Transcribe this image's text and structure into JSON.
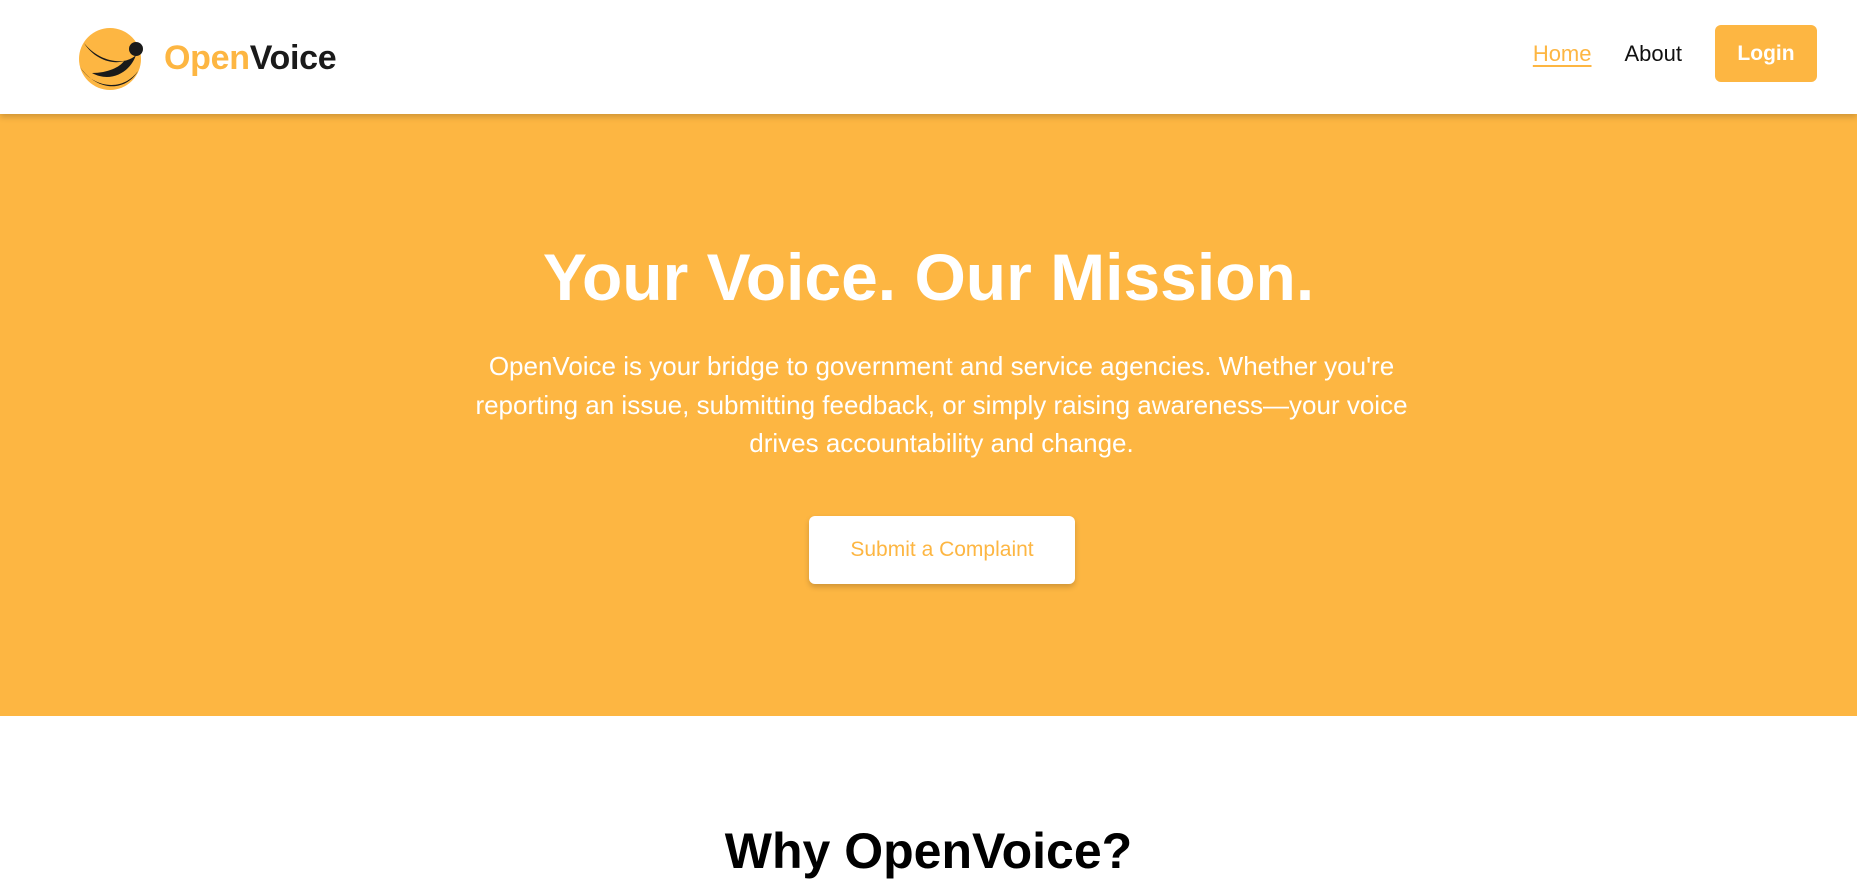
{
  "header": {
    "brand": {
      "prefix": "Open",
      "suffix": "Voice",
      "logo_icon": "openvoice-logo-icon"
    },
    "nav": {
      "home_label": "Home",
      "about_label": "About",
      "login_label": "Login",
      "active": "Home"
    }
  },
  "hero": {
    "title": "Your Voice. Our Mission.",
    "description": "OpenVoice is your bridge to government and service agencies. Whether you're reporting an issue, submitting feedback, or simply raising awareness—your voice drives accountability and change.",
    "cta_label": "Submit a Complaint"
  },
  "section": {
    "why_title": "Why OpenVoice?"
  },
  "colors": {
    "accent": "#FDB642",
    "dark": "#1a1a1a",
    "white": "#ffffff"
  }
}
